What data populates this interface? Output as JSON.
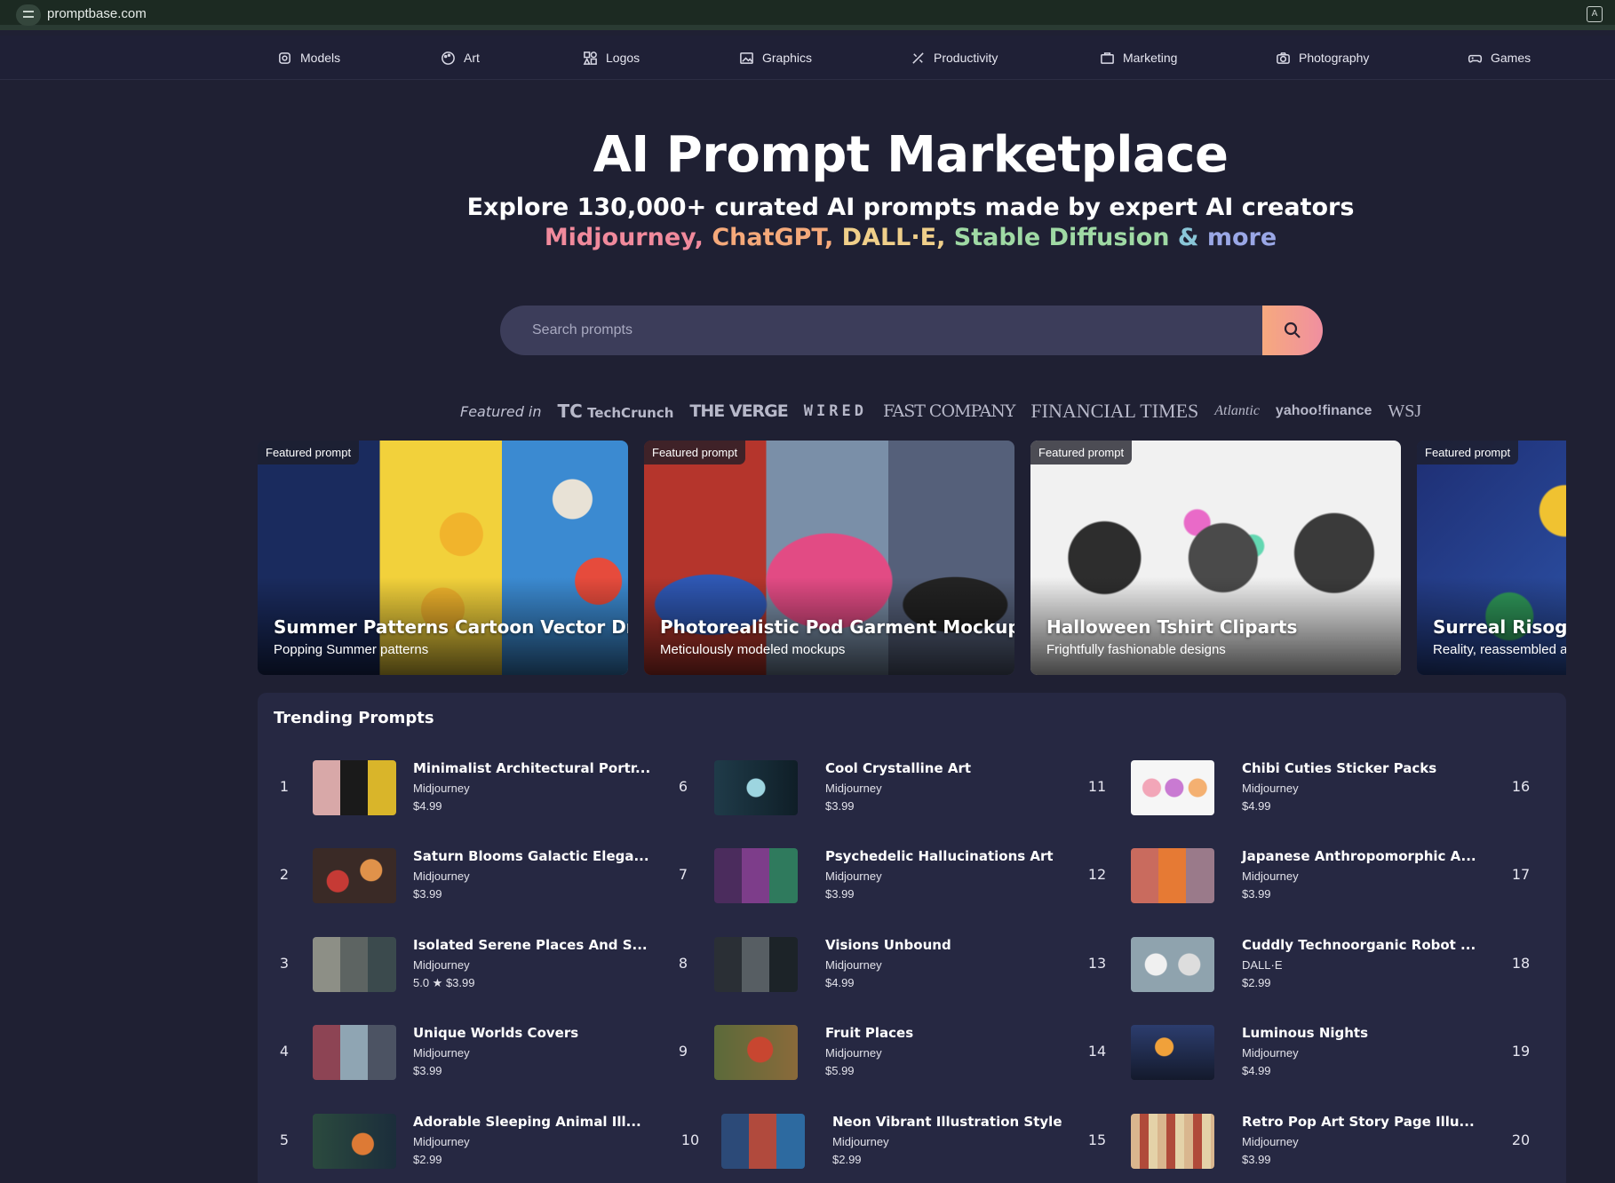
{
  "browser": {
    "url": "promptbase.com"
  },
  "nav": [
    {
      "label": "Models",
      "icon": "models-icon"
    },
    {
      "label": "Art",
      "icon": "palette-icon"
    },
    {
      "label": "Logos",
      "icon": "logos-icon"
    },
    {
      "label": "Graphics",
      "icon": "image-icon"
    },
    {
      "label": "Productivity",
      "icon": "productivity-icon"
    },
    {
      "label": "Marketing",
      "icon": "briefcase-icon"
    },
    {
      "label": "Photography",
      "icon": "camera-icon"
    },
    {
      "label": "Games",
      "icon": "gamepad-icon"
    }
  ],
  "hero": {
    "title": "AI Prompt Marketplace",
    "subtitle": "Explore 130,000+ curated AI prompts made by expert AI creators",
    "models": [
      "Midjourney,",
      "ChatGPT,",
      "DALL·E,",
      "Stable Diffusion",
      "&",
      "more"
    ],
    "model_colors": [
      "#f08a9c",
      "#f5a97a",
      "#f0cf8a",
      "#9fd9a4",
      "#8ac6d8",
      "#9aa7e6"
    ]
  },
  "search": {
    "placeholder": "Search prompts"
  },
  "featured_in": {
    "label": "Featured in",
    "logos": [
      "TechCrunch",
      "THE VERGE",
      "WIRED",
      "FAST COMPANY",
      "FINANCIAL TIMES",
      "Atlantic",
      "yahoo!finance",
      "WSJ"
    ]
  },
  "featured": [
    {
      "badge": "Featured prompt",
      "title": "Summer Patterns Cartoon Vector Drawings",
      "desc": "Popping Summer patterns"
    },
    {
      "badge": "Featured prompt",
      "title": "Photorealistic Pod Garment Mockups",
      "desc": "Meticulously modeled mockups"
    },
    {
      "badge": "Featured prompt",
      "title": "Halloween Tshirt Cliparts",
      "desc": "Frightfully fashionable designs"
    },
    {
      "badge": "Featured prompt",
      "title": "Surreal Risograph",
      "desc": "Reality, reassembled a"
    }
  ],
  "trending": {
    "title": "Trending Prompts",
    "items": [
      {
        "rank": "1",
        "title": "Minimalist Architectural Portr...",
        "model": "Midjourney",
        "price": "$4.99"
      },
      {
        "rank": "2",
        "title": "Saturn Blooms Galactic Elega...",
        "model": "Midjourney",
        "price": "$3.99"
      },
      {
        "rank": "3",
        "title": "Isolated Serene Places And S...",
        "model": "Midjourney",
        "price": "5.0 ★  $3.99"
      },
      {
        "rank": "4",
        "title": "Unique Worlds Covers",
        "model": "Midjourney",
        "price": "$3.99"
      },
      {
        "rank": "5",
        "title": "Adorable Sleeping Animal Ill...",
        "model": "Midjourney",
        "price": "$2.99"
      },
      {
        "rank": "6",
        "title": "Cool Crystalline Art",
        "model": "Midjourney",
        "price": "$3.99"
      },
      {
        "rank": "7",
        "title": "Psychedelic Hallucinations Art",
        "model": "Midjourney",
        "price": "$3.99"
      },
      {
        "rank": "8",
        "title": "Visions Unbound",
        "model": "Midjourney",
        "price": "$4.99"
      },
      {
        "rank": "9",
        "title": "Fruit Places",
        "model": "Midjourney",
        "price": "$5.99"
      },
      {
        "rank": "10",
        "title": "Neon Vibrant Illustration Style",
        "model": "Midjourney",
        "price": "$2.99"
      },
      {
        "rank": "11",
        "title": "Chibi Cuties Sticker Packs",
        "model": "Midjourney",
        "price": "$4.99"
      },
      {
        "rank": "12",
        "title": "Japanese Anthropomorphic A...",
        "model": "Midjourney",
        "price": "$3.99"
      },
      {
        "rank": "13",
        "title": "Cuddly Technoorganic Robot ...",
        "model": "DALL·E",
        "price": "$2.99"
      },
      {
        "rank": "14",
        "title": "Luminous Nights",
        "model": "Midjourney",
        "price": "$4.99"
      },
      {
        "rank": "15",
        "title": "Retro Pop Art Story Page Illu...",
        "model": "Midjourney",
        "price": "$3.99"
      }
    ],
    "right_ranks": [
      "16",
      "17",
      "18",
      "19",
      "20"
    ]
  }
}
